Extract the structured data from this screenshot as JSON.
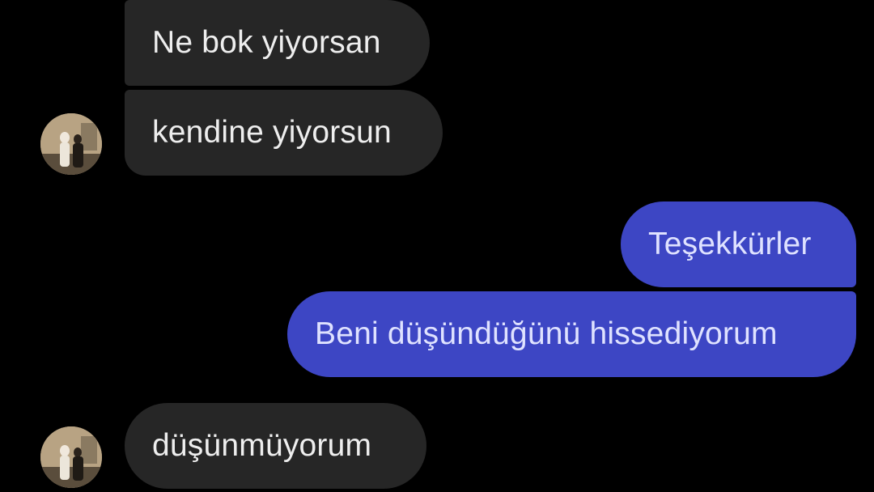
{
  "conversation": {
    "messages": [
      {
        "direction": "incoming",
        "text": "Ne bok yiyorsan"
      },
      {
        "direction": "incoming",
        "text": "kendine yiyorsun"
      },
      {
        "direction": "outgoing",
        "text": "Teşekkürler"
      },
      {
        "direction": "outgoing",
        "text": "Beni düşündüğünü hissediyorum"
      },
      {
        "direction": "incoming",
        "text": "düşünmüyorum"
      }
    ],
    "avatars": [
      {
        "icon": "contact-avatar-photo"
      },
      {
        "icon": "contact-avatar-photo"
      }
    ]
  },
  "colors": {
    "background": "#000000",
    "incoming_bubble": "#262626",
    "outgoing_bubble": "#3d46c4",
    "incoming_text": "#eeeeee",
    "outgoing_text": "#dfe2ff"
  }
}
